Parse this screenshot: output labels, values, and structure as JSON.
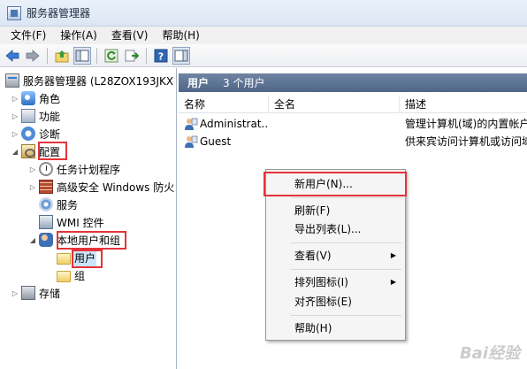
{
  "window": {
    "title": "服务器管理器"
  },
  "menu": [
    "文件(F)",
    "操作(A)",
    "查看(V)",
    "帮助(H)"
  ],
  "toolbar": {
    "buttons": [
      "back-icon",
      "forward-icon",
      "up-folder-icon",
      "show-tree-icon",
      "refresh-icon",
      "export-icon",
      "help-icon",
      "action-pane-icon"
    ]
  },
  "tree": {
    "root": "服务器管理器 (L28ZOX193JKX",
    "items": {
      "roles": "角色",
      "features": "功能",
      "diagnostics": "诊断",
      "configuration": "配置",
      "task_scheduler": "任务计划程序",
      "firewall": "高级安全 Windows 防火",
      "services": "服务",
      "wmi": "WMI 控件",
      "local_users": "本地用户和组",
      "users": "用户",
      "groups": "组",
      "storage": "存储"
    }
  },
  "list": {
    "header_title": "用户",
    "header_count": "3 个用户",
    "columns": [
      "名称",
      "全名",
      "描述"
    ],
    "rows": [
      {
        "name": "Administrat...",
        "fullname": "",
        "description": "管理计算机(域)的内置帐户"
      },
      {
        "name": "Guest",
        "fullname": "",
        "description": "供来宾访问计算机或访问域"
      }
    ]
  },
  "context_menu": {
    "new_user": "新用户(N)...",
    "refresh": "刷新(F)",
    "export_list": "导出列表(L)...",
    "view": "查看(V)",
    "arrange_icons": "排列图标(I)",
    "align_icons": "对齐图标(E)",
    "help": "帮助(H)"
  },
  "watermark": "Bai经验",
  "colors": {
    "highlight": "#e3343a",
    "header_bg": "#5d7394",
    "selection": "#cce4f7"
  }
}
